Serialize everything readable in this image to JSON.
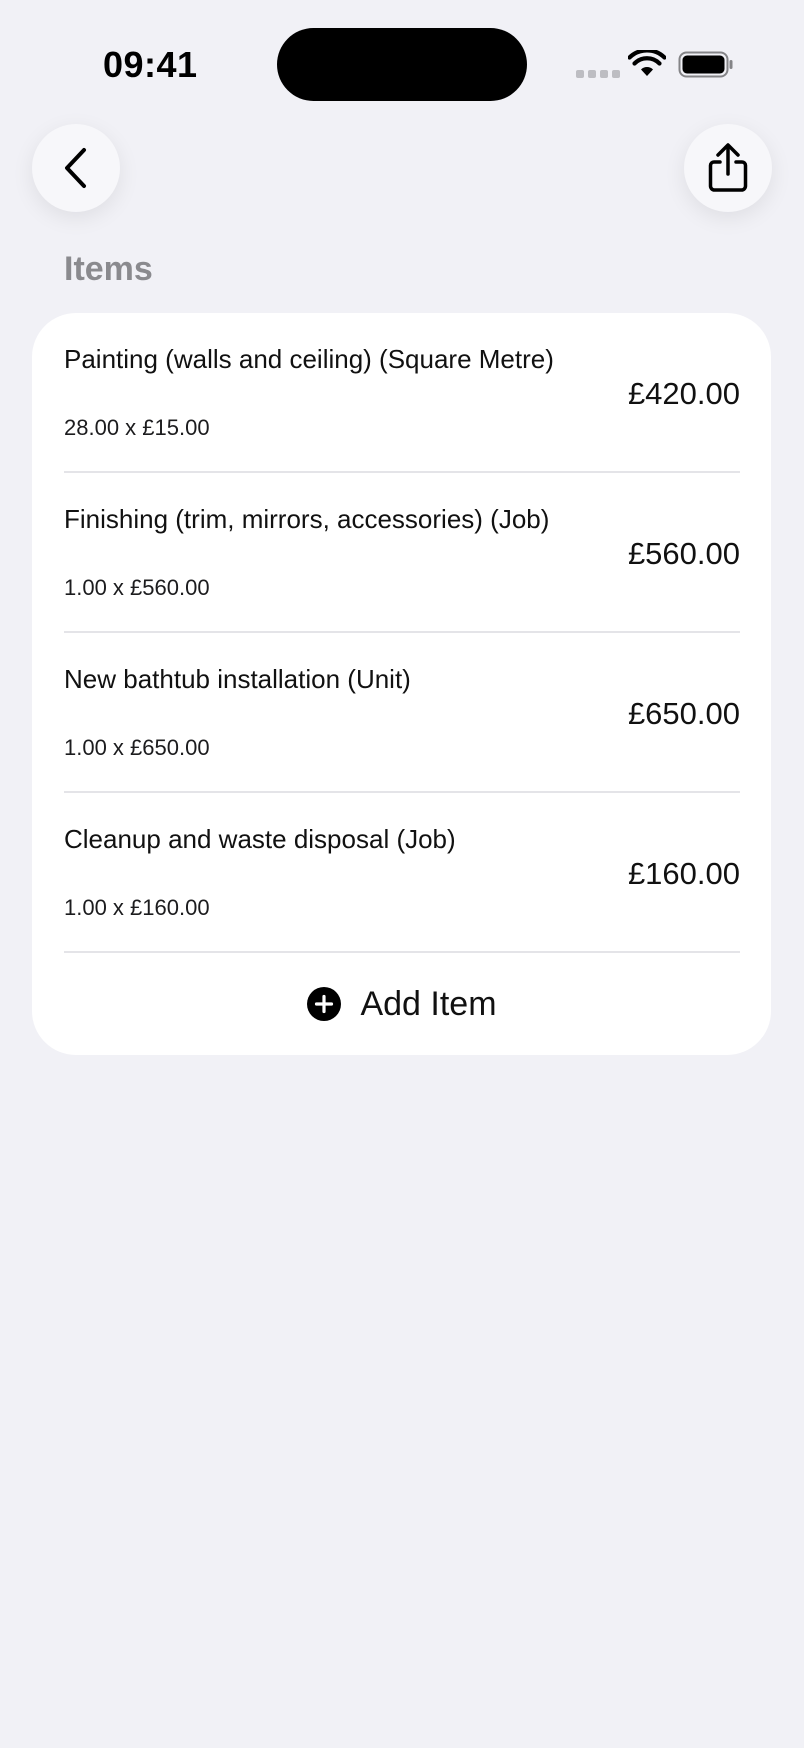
{
  "status_bar": {
    "time": "09:41",
    "icons": [
      "signal-icon",
      "wifi-icon",
      "battery-icon"
    ]
  },
  "nav": {
    "back_icon": "chevron-left-icon",
    "share_icon": "share-icon"
  },
  "section": {
    "title": "Items"
  },
  "items": [
    {
      "title": "Painting (walls and ceiling) (Square Metre)",
      "detail": "28.00 x £15.00",
      "amount": "£420.00"
    },
    {
      "title": "Finishing (trim, mirrors, accessories) (Job)",
      "detail": "1.00 x £560.00",
      "amount": "£560.00"
    },
    {
      "title": "New bathtub installation (Unit)",
      "detail": "1.00 x £650.00",
      "amount": "£650.00"
    },
    {
      "title": "Cleanup and waste disposal (Job)",
      "detail": "1.00 x £160.00",
      "amount": "£160.00"
    }
  ],
  "add_item": {
    "label": "Add Item",
    "icon": "plus-circle-icon"
  },
  "colors": {
    "background": "#f1f1f6",
    "card": "#ffffff",
    "section_title": "#8a8a8e",
    "divider": "#e4e4e8"
  }
}
